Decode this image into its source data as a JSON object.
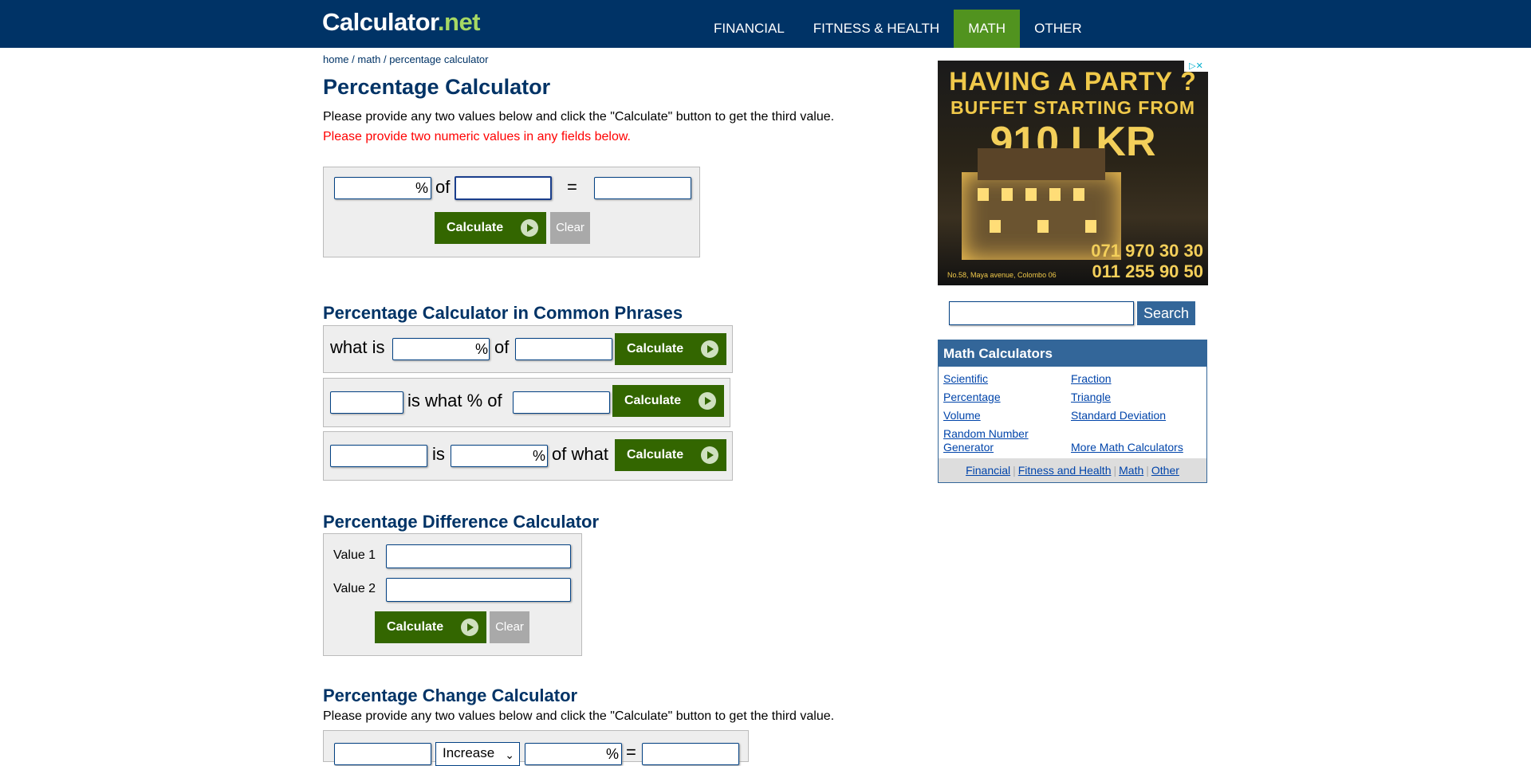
{
  "header": {
    "logo_main": "Calculator",
    "logo_suffix": ".net",
    "nav": [
      {
        "label": "FINANCIAL"
      },
      {
        "label": "FITNESS & HEALTH"
      },
      {
        "label": "MATH",
        "active": true
      },
      {
        "label": "OTHER"
      }
    ]
  },
  "breadcrumb": {
    "home": "home",
    "sep": "/",
    "math": "math",
    "current": "percentage calculator"
  },
  "main": {
    "title": "Percentage Calculator",
    "intro": "Please provide any two values below and click the \"Calculate\" button to get the third value.",
    "error": "Please provide two numeric values in any fields below.",
    "basic": {
      "percent_sign": "%",
      "of_word": "of",
      "equals": "=",
      "calculate": "Calculate",
      "clear": "Clear"
    },
    "phrases": {
      "title": "Percentage Calculator in Common Phrases",
      "row1": {
        "what_is": "what is",
        "percent_sign": "%",
        "of_word": "of",
        "calculate": "Calculate"
      },
      "row2": {
        "is_what_pct_of": "is what % of",
        "calculate": "Calculate"
      },
      "row3": {
        "is_word": "is",
        "percent_sign": "%",
        "of_what": "of what",
        "calculate": "Calculate"
      }
    },
    "difference": {
      "title": "Percentage Difference Calculator",
      "value1_label": "Value 1",
      "value2_label": "Value 2",
      "calculate": "Calculate",
      "clear": "Clear"
    },
    "change": {
      "title": "Percentage Change Calculator",
      "intro": "Please provide any two values below and click the \"Calculate\" button to get the third value.",
      "select_value": "Increase",
      "percent_sign": "%",
      "equals": "="
    }
  },
  "sidebar": {
    "ad": {
      "line1": "HAVING A PARTY ?",
      "line2": "BUFFET STARTING FROM",
      "line3": "910 LKR",
      "phone1": "071 970 30 30",
      "phone2": "011 255 90 50",
      "address": "No.58, Maya avenue, Colombo 06"
    },
    "search": {
      "button": "Search"
    },
    "math_calculators": {
      "title": "Math Calculators",
      "links_left": [
        "Scientific",
        "Percentage",
        "Volume",
        "Random Number Generator"
      ],
      "links_right": [
        "Fraction",
        "Triangle",
        "Standard Deviation",
        "More Math Calculators"
      ],
      "footer": [
        "Financial",
        "Fitness and Health",
        "Math",
        "Other"
      ],
      "footer_sep": "|"
    }
  },
  "colors": {
    "header_bg": "#003366",
    "nav_active": "#51931f",
    "title_blue": "#003366",
    "error_red": "#ff0000",
    "calc_button": "#336600",
    "clear_button": "#a9a9a9",
    "sidebar_blue": "#336699"
  }
}
